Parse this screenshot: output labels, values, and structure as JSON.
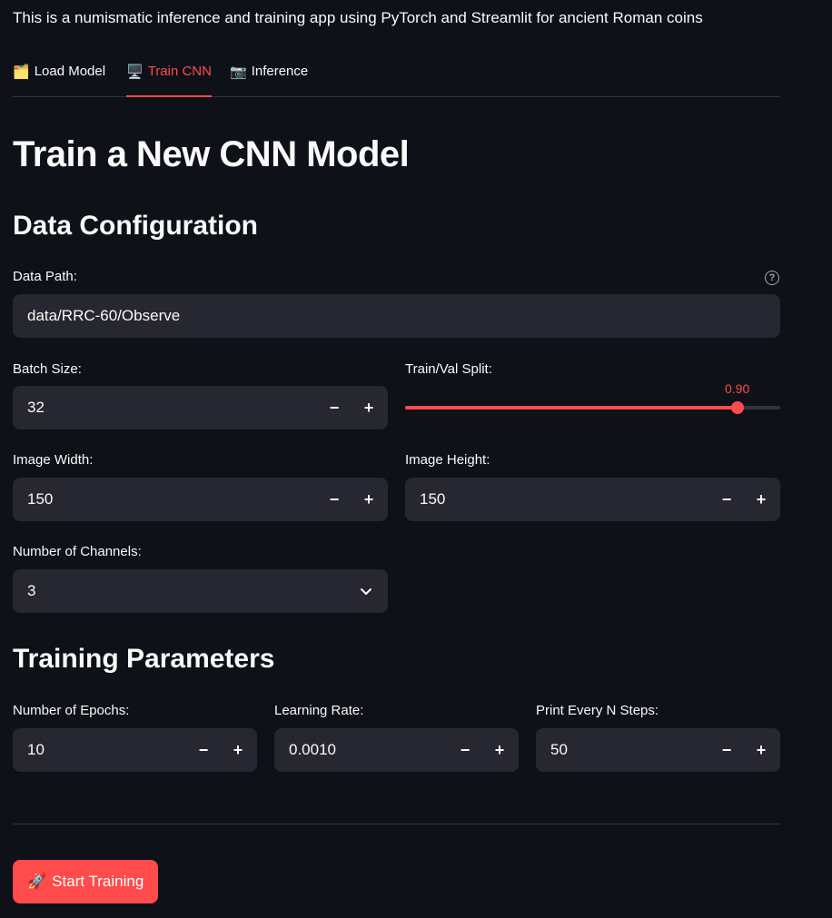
{
  "intro_text": "This is a numismatic inference and training app using PyTorch and Streamlit for ancient Roman coins",
  "tabs": [
    {
      "icon": "🗂️",
      "label": "Load Model",
      "active": false
    },
    {
      "icon": "🖥️",
      "label": "Train CNN",
      "active": true
    },
    {
      "icon": "📷",
      "label": "Inference",
      "active": false
    }
  ],
  "page_title": "Train a New CNN Model",
  "data_config": {
    "heading": "Data Configuration",
    "data_path": {
      "label": "Data Path:",
      "value": "data/RRC-60/Observe"
    },
    "batch_size": {
      "label": "Batch Size:",
      "value": "32"
    },
    "split": {
      "label": "Train/Val Split:",
      "value": "0.90",
      "fraction": 0.9
    },
    "image_width": {
      "label": "Image Width:",
      "value": "150"
    },
    "image_height": {
      "label": "Image Height:",
      "value": "150"
    },
    "channels": {
      "label": "Number of Channels:",
      "value": "3"
    }
  },
  "training": {
    "heading": "Training Parameters",
    "epochs": {
      "label": "Number of Epochs:",
      "value": "10"
    },
    "learning_rate": {
      "label": "Learning Rate:",
      "value": "0.0010"
    },
    "print_every": {
      "label": "Print Every N Steps:",
      "value": "50"
    }
  },
  "start_button": {
    "icon": "🚀",
    "label": "Start Training"
  },
  "stepper": {
    "minus": "−",
    "plus": "+"
  },
  "colors": {
    "accent": "#ff4b4b",
    "background": "#0e1117",
    "input_bg": "#262730"
  }
}
